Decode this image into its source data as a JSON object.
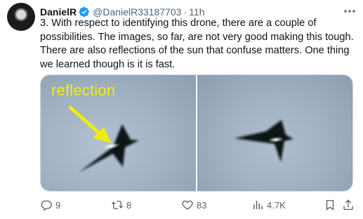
{
  "tweet": {
    "author_name": "DanielR",
    "handle": "@DanielR33187703",
    "separator": "·",
    "time": "11h",
    "text": "3. With respect to identifying this drone, there are a couple of possibilities. The images, so far, are not very good making this tough. There are also reflections of the sun that confuse matters. One thing we learned though is it is fast."
  },
  "media": {
    "annotation_label": "reflection",
    "annotation_color": "#f3f000"
  },
  "actions": {
    "replies": "9",
    "reposts": "8",
    "likes": "83",
    "views": "4.7K"
  },
  "icons": {
    "verified": "verified-badge-icon",
    "more": "more-icon",
    "reply": "reply-icon",
    "repost": "repost-icon",
    "like": "like-icon",
    "views": "views-icon",
    "bookmark": "bookmark-icon",
    "share": "share-icon"
  },
  "colors": {
    "verified": "#1d9bf0",
    "secondary_text": "#536471"
  }
}
